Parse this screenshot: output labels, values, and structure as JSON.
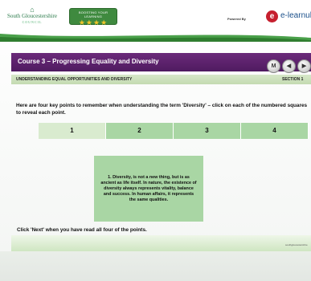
{
  "header": {
    "logo_line1": "South Gloucestershire",
    "logo_line2": "COUNCIL",
    "badge_text": "BOOSTING YOUR LEARNING",
    "badge_stars": "★★★★",
    "powered_by": "Powered By",
    "elogo_letter": "e",
    "brand_name": "e-learnuk.co"
  },
  "course": {
    "title": "Course 3 – Progressing Equality and Diversity",
    "subtitle": "UNDERSTANDING EQUAL OPPORTUNITIES AND DIVERSITY",
    "section": "SECTION 1"
  },
  "nav": {
    "menu": "M",
    "back": "◀",
    "next": "▶"
  },
  "instruction": "Here are four key points to remember when understanding the term 'Diversity' – click on each of the numbered squares to reveal each point.",
  "tabs": [
    "1",
    "2",
    "3",
    "4"
  ],
  "active_tab": 0,
  "point_text": "1. Diversity, is not a new thing, but is as ancient as life itself. In nature, the existence of diversity always represents vitality, balance and success. In human affairs, it represents the same qualities.",
  "footer_text": "Click 'Next' when you have read all four of the points.",
  "footer_url": "southgloucestershire",
  "colors": {
    "title_bar": "#5a2070",
    "tab_green": "#a9d6a4",
    "tab_active": "#d9ebcf",
    "brand_red": "#c61f2e"
  }
}
